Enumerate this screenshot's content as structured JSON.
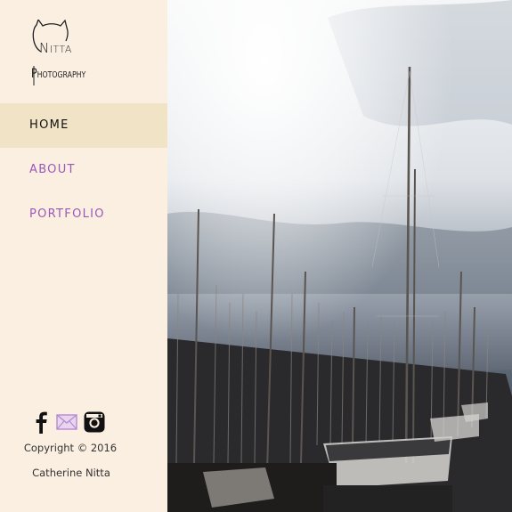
{
  "brand": {
    "line1": "Nitta",
    "line2": "Photography",
    "icon": "cat-icon"
  },
  "nav": {
    "items": [
      {
        "label": "HOME",
        "active": true
      },
      {
        "label": "ABOUT",
        "active": false
      },
      {
        "label": "PORTFOLIO",
        "active": false
      }
    ]
  },
  "social": {
    "facebook_icon": "facebook-icon",
    "mail_icon": "mail-icon",
    "instagram_icon": "instagram-icon"
  },
  "footer": {
    "copyright": "Copyright © 2016",
    "author": "Catherine Nitta"
  },
  "hero": {
    "image": "marina-sailboat-masts-photo"
  },
  "colors": {
    "sidebar_bg": "#fbefe2",
    "nav_active_bg": "#f1e4c6",
    "nav_link": "#9b59b6",
    "mail_icon": "#b48ad4"
  }
}
